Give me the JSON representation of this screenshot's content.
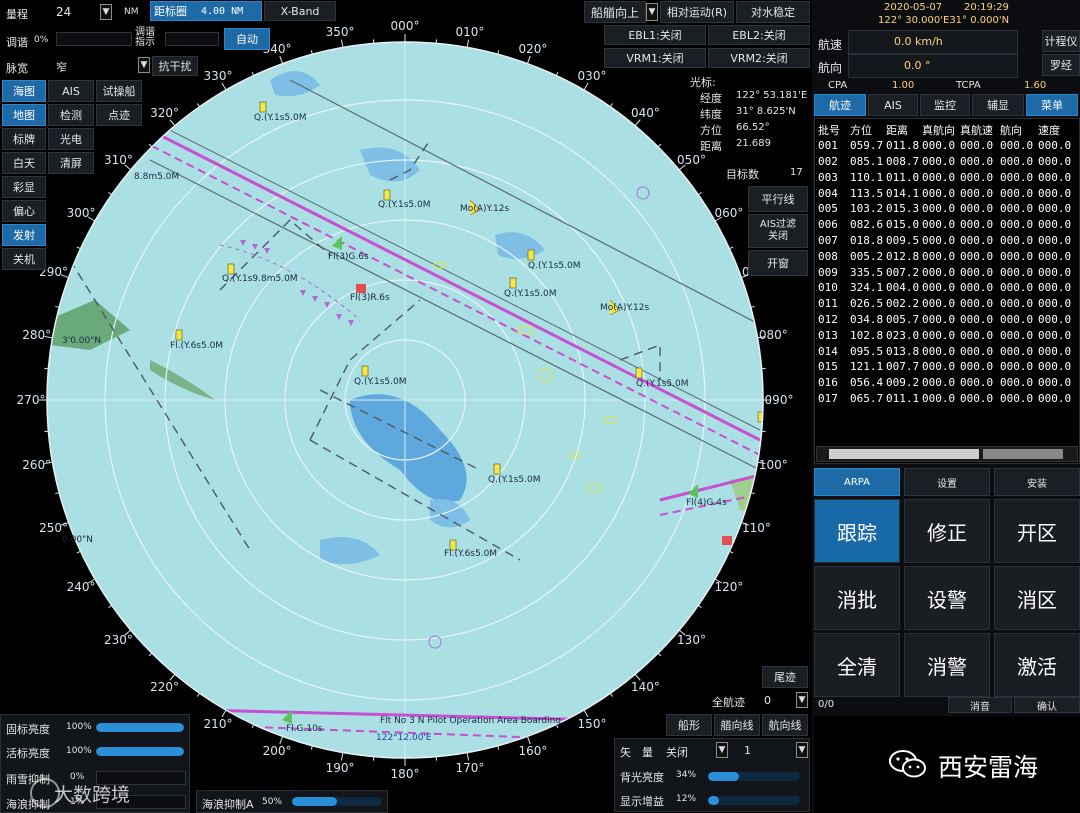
{
  "top_left": {
    "range_label": "量程",
    "range_value": "24",
    "range_unit": "NM",
    "ring_label": "距标圈",
    "ring_value": "4.00 NM",
    "band": "X-Band",
    "tune_label": "调谐",
    "tune_value": "0%",
    "tune_indicator_label": "调谐指示",
    "auto_button": "自动",
    "pulse_label": "脉宽",
    "pulse_value": "窄",
    "anti_interference": "抗干扰"
  },
  "left_buttons": [
    "海图",
    "AIS",
    "试操船",
    "地图",
    "检测",
    "点迹",
    "标牌",
    "光电",
    "白天",
    "清屏",
    "彩显",
    "偏心",
    "发射",
    "关机"
  ],
  "top_center": {
    "orientation": "船艏向上",
    "motion": "相对运动(R)",
    "stabilize": "对水稳定",
    "ebl1": "EBL1:关闭",
    "ebl2": "EBL2:关闭",
    "vrm1": "VRM1:关闭",
    "vrm2": "VRM2:关闭"
  },
  "cursor": {
    "title": "光标:",
    "lon_label": "经度",
    "lon": "122° 53.181'E",
    "lat_label": "纬度",
    "lat": "31° 8.625'N",
    "bearing_label": "方位",
    "bearing": "66.52°",
    "distance_label": "距离",
    "distance": "21.689",
    "targets_label": "目标数",
    "targets": "17"
  },
  "radar_side_buttons": [
    "平行线",
    "AIS过滤\n关闭",
    "开窗"
  ],
  "radar_bottom_right": {
    "tail": "尾迹",
    "full_track_label": "全航迹",
    "full_track_value": "0",
    "ship_shape": "船形",
    "heading_line": "艏向线",
    "track_line": "航向线"
  },
  "bottom_left": {
    "fixed_brightness": "固标亮度",
    "fixed_brightness_value": "100%",
    "fixed_brightness_pct": 100,
    "live_brightness": "活标亮度",
    "live_brightness_value": "100%",
    "live_brightness_pct": 100,
    "rain_suppress": "雨雪抑制",
    "rain_value": "0%",
    "sea_suppress": "海浪抑制",
    "sea_value": "1%",
    "sea_suppress_a": "海浪抑制A",
    "sea_a_value": "50%",
    "sea_a_pct": 50
  },
  "bottom_center": {
    "vector_label": "矢　量",
    "vector_value": "关闭",
    "vector_num": "1",
    "backlight_label": "背光亮度",
    "backlight_value": "34%",
    "backlight_pct": 34,
    "gain_label": "显示增益",
    "gain_value": "12%",
    "gain_pct": 12
  },
  "right_header": {
    "date": "2020-05-07",
    "time": "20:19:29",
    "position": "122° 30.000'E31° 0.000'N",
    "speed_label": "航速",
    "speed_value": "0.0 km/h",
    "speed_src": "计程仪",
    "course_label": "航向",
    "course_value": "0.0 °",
    "course_src": "罗经",
    "cpa_label": "CPA",
    "cpa_value": "1.00",
    "tcpa_label": "TCPA",
    "tcpa_value": "1.60"
  },
  "right_tabs": [
    "航迹",
    "AIS",
    "监控",
    "辅显",
    "菜单"
  ],
  "target_table": {
    "headers": [
      "批号",
      "方位",
      "距离",
      "真航向",
      "真航速",
      "航向",
      "速度"
    ],
    "rows": [
      [
        "001",
        "059.7",
        "011.8",
        "000.0",
        "000.0",
        "000.0",
        "000.0"
      ],
      [
        "002",
        "085.1",
        "008.7",
        "000.0",
        "000.0",
        "000.0",
        "000.0"
      ],
      [
        "003",
        "110.1",
        "011.0",
        "000.0",
        "000.0",
        "000.0",
        "000.0"
      ],
      [
        "004",
        "113.5",
        "014.1",
        "000.0",
        "000.0",
        "000.0",
        "000.0"
      ],
      [
        "005",
        "103.2",
        "015.3",
        "000.0",
        "000.0",
        "000.0",
        "000.0"
      ],
      [
        "006",
        "082.6",
        "015.0",
        "000.0",
        "000.0",
        "000.0",
        "000.0"
      ],
      [
        "007",
        "018.8",
        "009.5",
        "000.0",
        "000.0",
        "000.0",
        "000.0"
      ],
      [
        "008",
        "005.2",
        "012.8",
        "000.0",
        "000.0",
        "000.0",
        "000.0"
      ],
      [
        "009",
        "335.5",
        "007.2",
        "000.0",
        "000.0",
        "000.0",
        "000.0"
      ],
      [
        "010",
        "324.1",
        "004.0",
        "000.0",
        "000.0",
        "000.0",
        "000.0"
      ],
      [
        "011",
        "026.5",
        "002.2",
        "000.0",
        "000.0",
        "000.0",
        "000.0"
      ],
      [
        "012",
        "034.8",
        "005.7",
        "000.0",
        "000.0",
        "000.0",
        "000.0"
      ],
      [
        "013",
        "102.8",
        "023.0",
        "000.0",
        "000.0",
        "000.0",
        "000.0"
      ],
      [
        "014",
        "095.5",
        "013.8",
        "000.0",
        "000.0",
        "000.0",
        "000.0"
      ],
      [
        "015",
        "121.1",
        "007.7",
        "000.0",
        "000.0",
        "000.0",
        "000.0"
      ],
      [
        "016",
        "056.4",
        "009.2",
        "000.0",
        "000.0",
        "000.0",
        "000.0"
      ],
      [
        "017",
        "065.7",
        "011.1",
        "000.0",
        "000.0",
        "000.0",
        "000.0"
      ]
    ]
  },
  "arpa_tabs": [
    "ARPA",
    "设置",
    "安装"
  ],
  "arpa_buttons": [
    "跟踪",
    "修正",
    "开区",
    "消批",
    "设警",
    "消区",
    "全清",
    "消警",
    "激活"
  ],
  "status_bar": {
    "count": "0/0",
    "mute": "消音",
    "confirm": "确认"
  },
  "watermark_left": "大数跨境",
  "watermark_right": "西安雷海",
  "bearings": [
    "000°",
    "010°",
    "020°",
    "030°",
    "040°",
    "050°",
    "060°",
    "070°",
    "080°",
    "090°",
    "100°",
    "110°",
    "120°",
    "130°",
    "140°",
    "150°",
    "160°",
    "170°",
    "180°",
    "190°",
    "200°",
    "210°",
    "220°",
    "230°",
    "240°",
    "250°",
    "260°",
    "270°",
    "280°",
    "290°",
    "300°",
    "310°",
    "320°",
    "330°",
    "340°",
    "350°"
  ],
  "chart_labels": {
    "buoy1": "Q.(Y.1s5.0M",
    "buoy2": "Q.(Y.1s5.0M",
    "buoy3": "Q.(Y.1s9.8m5.0M",
    "buoy4": "Fl.(Y.6s5.0M",
    "buoy5": "Q.(Y.1s5.0M",
    "buoy6": "Fl.(Y.6s5.0M",
    "buoy7": "Q.(Y.1s5.0M",
    "buoy8": "Q.(Y.1s5.0M",
    "buoy9": "Q.(Y.1s5.0M",
    "buoy10": "Fl.(Y.6s5.0M",
    "buoy11": "Q.(Y.1s5.0M",
    "mo1": "Mo(A)Y.12s",
    "mo2": "Mo(A)Y.12s",
    "fl_g": "Fl(3)G.6s",
    "fl_r": "Fl(3)R.6s",
    "fl_g10": "Fl.G.10s",
    "fl4g": "Fl(4)G.4s",
    "edge_310": "8.8m5.0M",
    "lat_280": "3'0.00\"N",
    "lat_110": "0.00\"N",
    "pilot": "Flt No 3 N Pilot Operation Area Boarding",
    "lon_bottom": "122°12.00'E"
  },
  "colors": {
    "sea": "#a9dfe3",
    "active_btn": "#1e6aa6",
    "channel": "#c84fd0"
  }
}
